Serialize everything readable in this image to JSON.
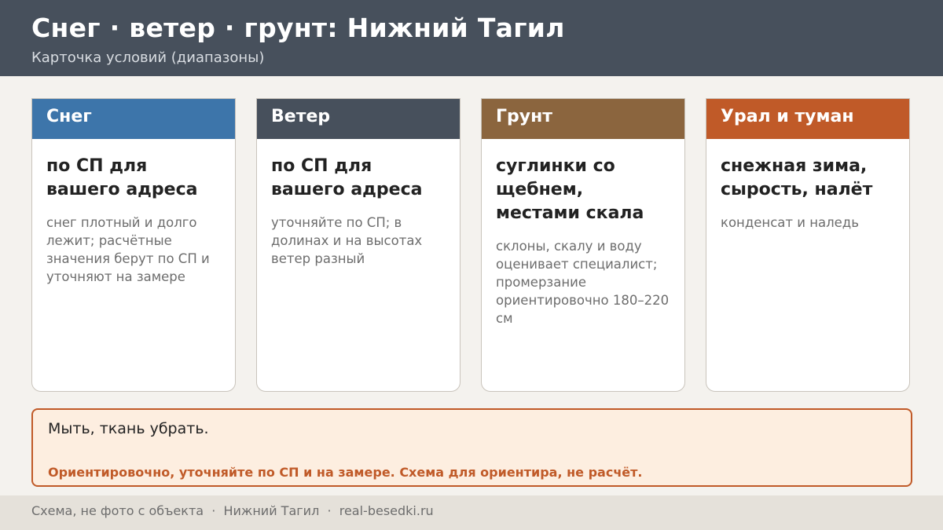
{
  "header": {
    "title": "Снег · ветер · грунт: Нижний Тагил",
    "subtitle": "Карточка условий (диапазоны)"
  },
  "cards": [
    {
      "label": "Снег",
      "color": "#3d75aa",
      "main": "по СП для вашего адреса",
      "note": "снег плотный и долго лежит; расчётные значения берут по СП и уточняют на замере"
    },
    {
      "label": "Ветер",
      "color": "#47505c",
      "main": "по СП для вашего адреса",
      "note": "уточняйте по СП; в долинах и на высотах ветер разный"
    },
    {
      "label": "Грунт",
      "color": "#8b653e",
      "main": "суглинки со щебнем, местами скала",
      "note": "склоны, скалу и воду оценивает специалист; промерзание ориентировочно 180–220 см"
    },
    {
      "label": "Урал и туман",
      "color": "#c05a28",
      "main": "снежная зима, сырость, налёт",
      "note": "конденсат и наледь"
    }
  ],
  "note_box": {
    "text": "Мыть, ткань убрать.",
    "warning": "Ориентировочно, уточняйте по СП и на замере. Схема для ориентира, не расчёт."
  },
  "footer": {
    "text": "Схема, не фото с объекта  ·  Нижний Тагил  ·  real-besedki.ru"
  }
}
